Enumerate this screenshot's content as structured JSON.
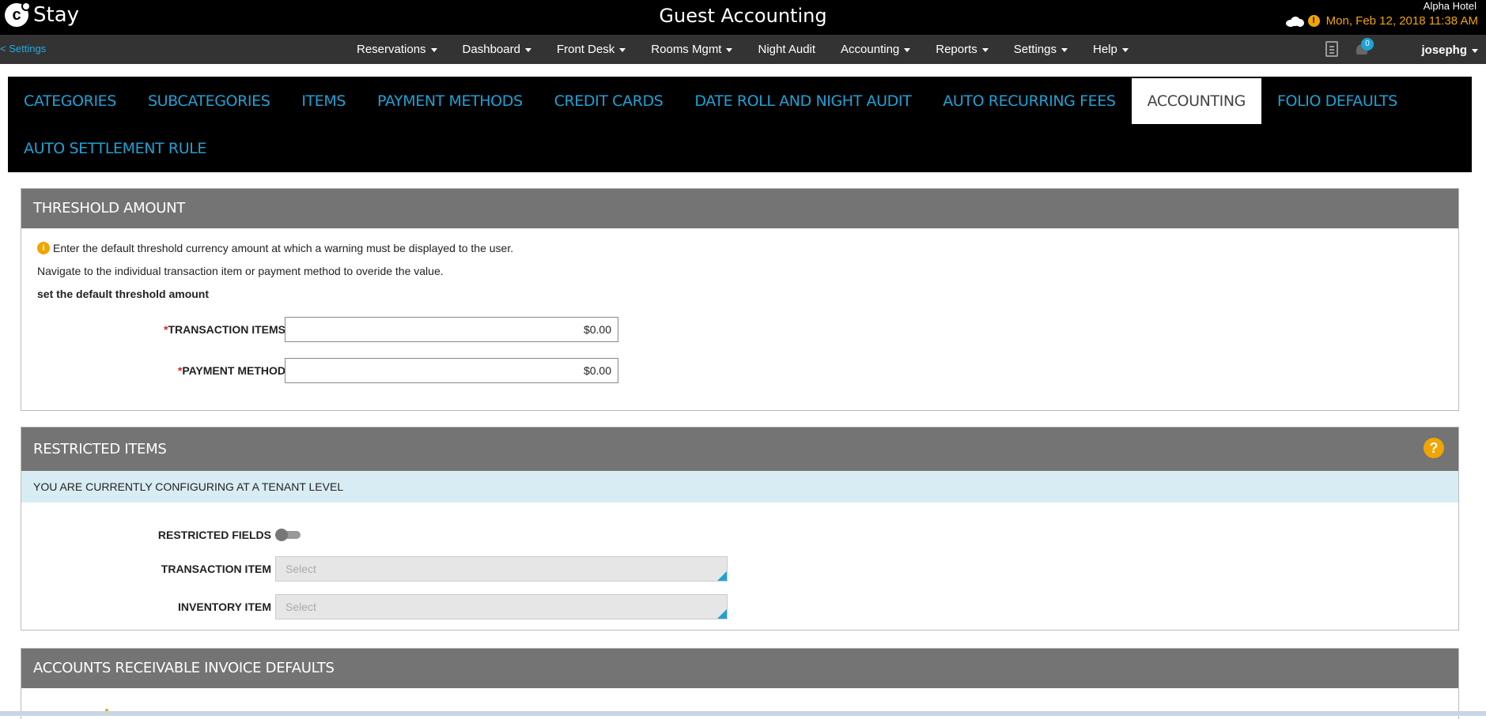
{
  "app": {
    "logo_letter": "c",
    "logo_text": "Stay",
    "title": "Guest Accounting",
    "hotel": "Alpha Hotel",
    "datetime": "Mon, Feb 12, 2018 11:38 AM",
    "accent_color": "#1fa1d4",
    "warning_color": "#f0a500"
  },
  "navbar": {
    "back_label": "< Settings",
    "items": [
      {
        "label": "Reservations",
        "dropdown": true
      },
      {
        "label": "Dashboard",
        "dropdown": true
      },
      {
        "label": "Front Desk",
        "dropdown": true
      },
      {
        "label": "Rooms Mgmt",
        "dropdown": true
      },
      {
        "label": "Night Audit",
        "dropdown": false
      },
      {
        "label": "Accounting",
        "dropdown": true
      },
      {
        "label": "Reports",
        "dropdown": true
      },
      {
        "label": "Settings",
        "dropdown": true
      },
      {
        "label": "Help",
        "dropdown": true
      }
    ],
    "notification_count": "0",
    "user": "josephg"
  },
  "tabs": {
    "row1": [
      "CATEGORIES",
      "SUBCATEGORIES",
      "ITEMS",
      "PAYMENT METHODS",
      "CREDIT CARDS",
      "DATE ROLL AND NIGHT AUDIT",
      "AUTO RECURRING FEES",
      "ACCOUNTING",
      "FOLIO DEFAULTS"
    ],
    "row2": [
      "AUTO SETTLEMENT RULE"
    ],
    "active": "ACCOUNTING"
  },
  "threshold": {
    "title": "THRESHOLD AMOUNT",
    "info1": "Enter the default threshold currency amount at which a warning must be displayed to the user.",
    "info2": "Navigate to the individual transaction item or payment method to overide the value.",
    "subheading": "set the default threshold amount",
    "required_mark": "*",
    "transaction_label": "TRANSACTION ITEMS",
    "transaction_value": "$0.00",
    "payment_label": "PAYMENT METHOD",
    "payment_value": "$0.00"
  },
  "restricted": {
    "title": "RESTRICTED ITEMS",
    "tenant_notice": "YOU ARE CURRENTLY CONFIGURING AT A TENANT LEVEL",
    "fields_label": "RESTRICTED FIELDS",
    "fields_on": false,
    "transaction_label": "TRANSACTION ITEM",
    "transaction_placeholder": "Select",
    "inventory_label": "INVENTORY ITEM",
    "inventory_placeholder": "Select"
  },
  "ar_defaults": {
    "title": "ACCOUNTS RECEIVABLE INVOICE DEFAULTS"
  }
}
